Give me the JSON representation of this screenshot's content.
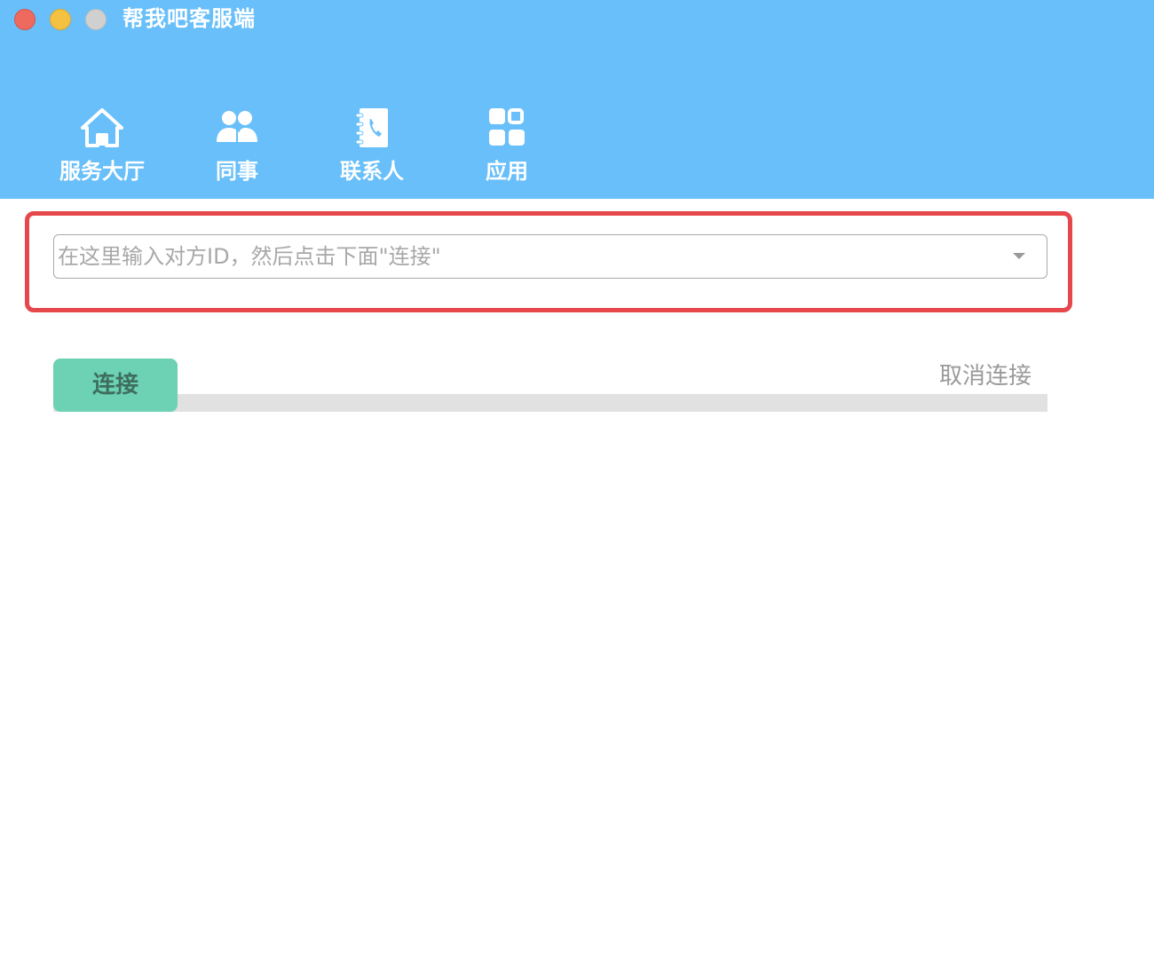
{
  "window": {
    "title": "帮我吧客服端",
    "controls": [
      "close",
      "minimize",
      "maximize"
    ]
  },
  "nav": {
    "items": [
      {
        "label": "服务大厅",
        "icon": "home-icon"
      },
      {
        "label": "同事",
        "icon": "colleagues-icon"
      },
      {
        "label": "联系人",
        "icon": "contacts-book-icon"
      },
      {
        "label": "应用",
        "icon": "apps-grid-icon"
      }
    ]
  },
  "connect": {
    "input_placeholder": "在这里输入对方ID，然后点击下面\"连接\"",
    "input_value": "",
    "connect_label": "连接",
    "cancel_label": "取消连接",
    "progress": 0
  },
  "colors": {
    "header": "#68bff9",
    "highlight": "#e5474b",
    "connect_button": "#6dd1b4",
    "progress_track": "#e1e1e1"
  }
}
